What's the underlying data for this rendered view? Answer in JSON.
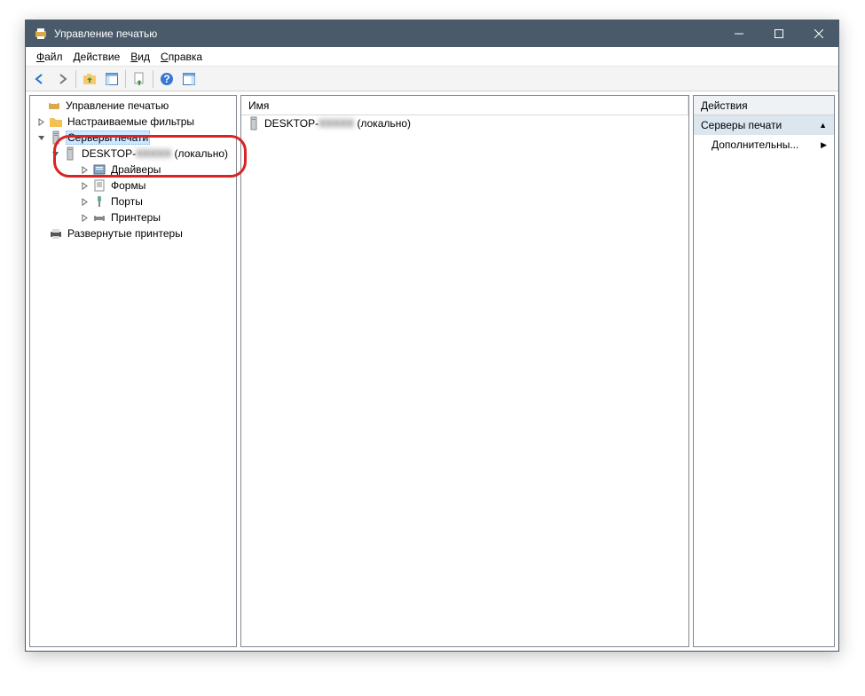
{
  "window": {
    "title": "Управление печатью"
  },
  "menu": {
    "file": "Файл",
    "action": "Действие",
    "view": "Вид",
    "help": "Справка"
  },
  "tree": {
    "root": "Управление печатью",
    "filters": "Настраиваемые фильтры",
    "servers": "Серверы печати",
    "desktop_prefix": "DESKTOP-",
    "desktop_hidden": "XXXXX",
    "desktop_suffix": " (локально)",
    "drivers": "Драйверы",
    "forms": "Формы",
    "ports": "Порты",
    "printers": "Принтеры",
    "deployed": "Развернутые принтеры"
  },
  "list": {
    "col_name": "Имя",
    "item_prefix": "DESKTOP-",
    "item_hidden": "XXXXX",
    "item_suffix": " (локально)"
  },
  "actions": {
    "header": "Действия",
    "section": "Серверы печати",
    "more": "Дополнительны..."
  }
}
